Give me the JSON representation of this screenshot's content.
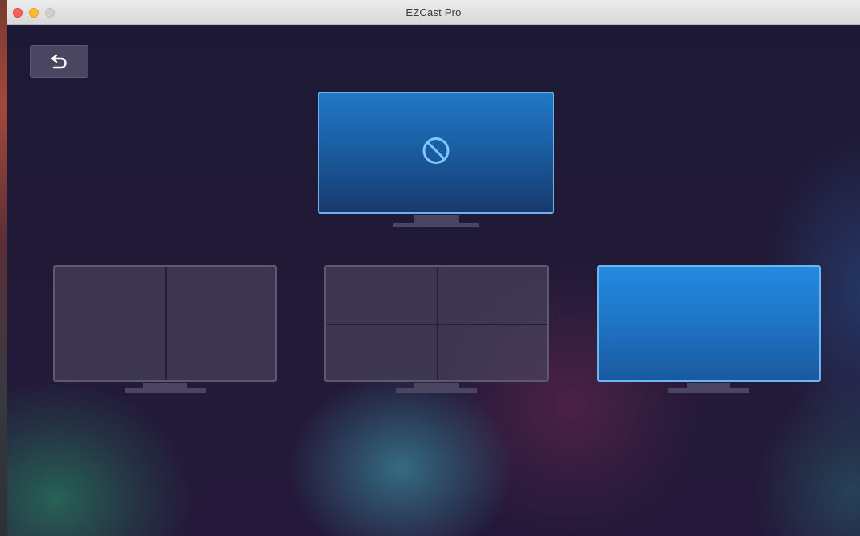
{
  "window": {
    "title": "EZCast Pro"
  },
  "toolbar": {
    "back_icon": "undo-arrow-icon"
  },
  "layouts": [
    {
      "id": "single-top",
      "state": "selected",
      "icon": "no-entry-icon"
    },
    {
      "id": "split-two",
      "state": "unselected"
    },
    {
      "id": "split-four",
      "state": "unselected"
    },
    {
      "id": "full-screen",
      "state": "selected"
    }
  ],
  "colors": {
    "background": "#1e1a33",
    "accent_blue": "#1f74c4",
    "accent_border": "#6cb1ea",
    "panel_gray": "#4e4860",
    "close": "#fc5f57",
    "minimize": "#fdbc2e",
    "zoom": "#d0d0d0"
  }
}
